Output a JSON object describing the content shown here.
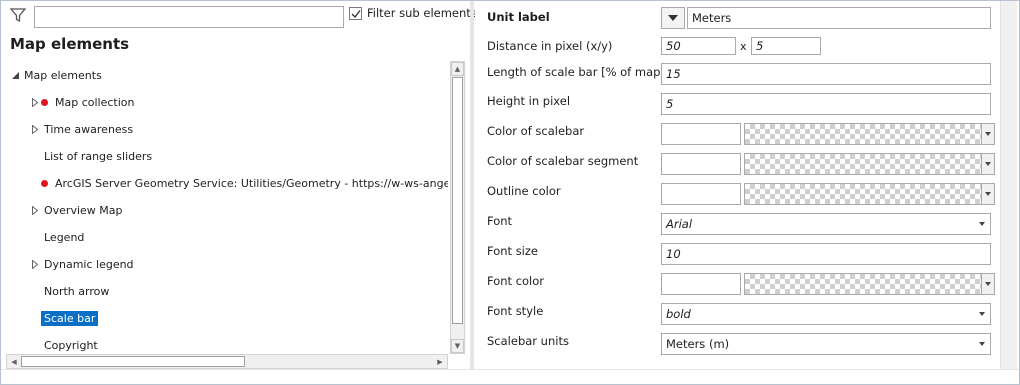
{
  "left_panel": {
    "filter_value": "",
    "filter_sub_elements_label": "Filter sub elements",
    "filter_sub_elements_checked": true,
    "title": "Map elements",
    "tree": [
      {
        "label": "Map elements",
        "level": 0,
        "expander": "expanded",
        "error": false,
        "selected": false
      },
      {
        "label": "Map collection",
        "level": 1,
        "expander": "collapsed",
        "error": true,
        "selected": false
      },
      {
        "label": "Time awareness",
        "level": 1,
        "expander": "collapsed",
        "error": false,
        "selected": false
      },
      {
        "label": "List of range sliders",
        "level": 1,
        "expander": "none",
        "error": false,
        "selected": false
      },
      {
        "label": "ArcGIS Server Geometry Service: Utilities/Geometry - https://w-ws-angerer.sy",
        "level": 1,
        "expander": "none",
        "error": true,
        "selected": false
      },
      {
        "label": "Overview Map",
        "level": 1,
        "expander": "collapsed",
        "error": false,
        "selected": false
      },
      {
        "label": "Legend",
        "level": 1,
        "expander": "none",
        "error": false,
        "selected": false
      },
      {
        "label": "Dynamic legend",
        "level": 1,
        "expander": "collapsed",
        "error": false,
        "selected": false
      },
      {
        "label": "North arrow",
        "level": 1,
        "expander": "none",
        "error": false,
        "selected": false
      },
      {
        "label": "Scale bar",
        "level": 1,
        "expander": "none",
        "error": false,
        "selected": true
      },
      {
        "label": "Copyright",
        "level": 1,
        "expander": "none",
        "error": false,
        "selected": false
      }
    ]
  },
  "properties": {
    "unit_label": {
      "label": "Unit label",
      "value": "Meters"
    },
    "distance_in_pixel": {
      "label": "Distance in pixel (x/y)",
      "x": "50",
      "separator": "x",
      "y": "5"
    },
    "length_of_scale_bar": {
      "label": "Length of scale bar [% of map]",
      "value": "15"
    },
    "height_in_pixel": {
      "label": "Height in pixel",
      "value": "5"
    },
    "color_of_scalebar": {
      "label": "Color of scalebar",
      "value": ""
    },
    "color_of_scalebar_segment": {
      "label": "Color of scalebar segment",
      "value": ""
    },
    "outline_color": {
      "label": "Outline color",
      "value": ""
    },
    "font": {
      "label": "Font",
      "value": "Arial"
    },
    "font_size": {
      "label": "Font size",
      "value": "10"
    },
    "font_color": {
      "label": "Font color",
      "value": ""
    },
    "font_style": {
      "label": "Font style",
      "value": "bold"
    },
    "scalebar_units": {
      "label": "Scalebar units",
      "value": "Meters (m)"
    }
  },
  "colors": {
    "selection": "#0b6fc5",
    "error_dot": "#e0141e"
  }
}
